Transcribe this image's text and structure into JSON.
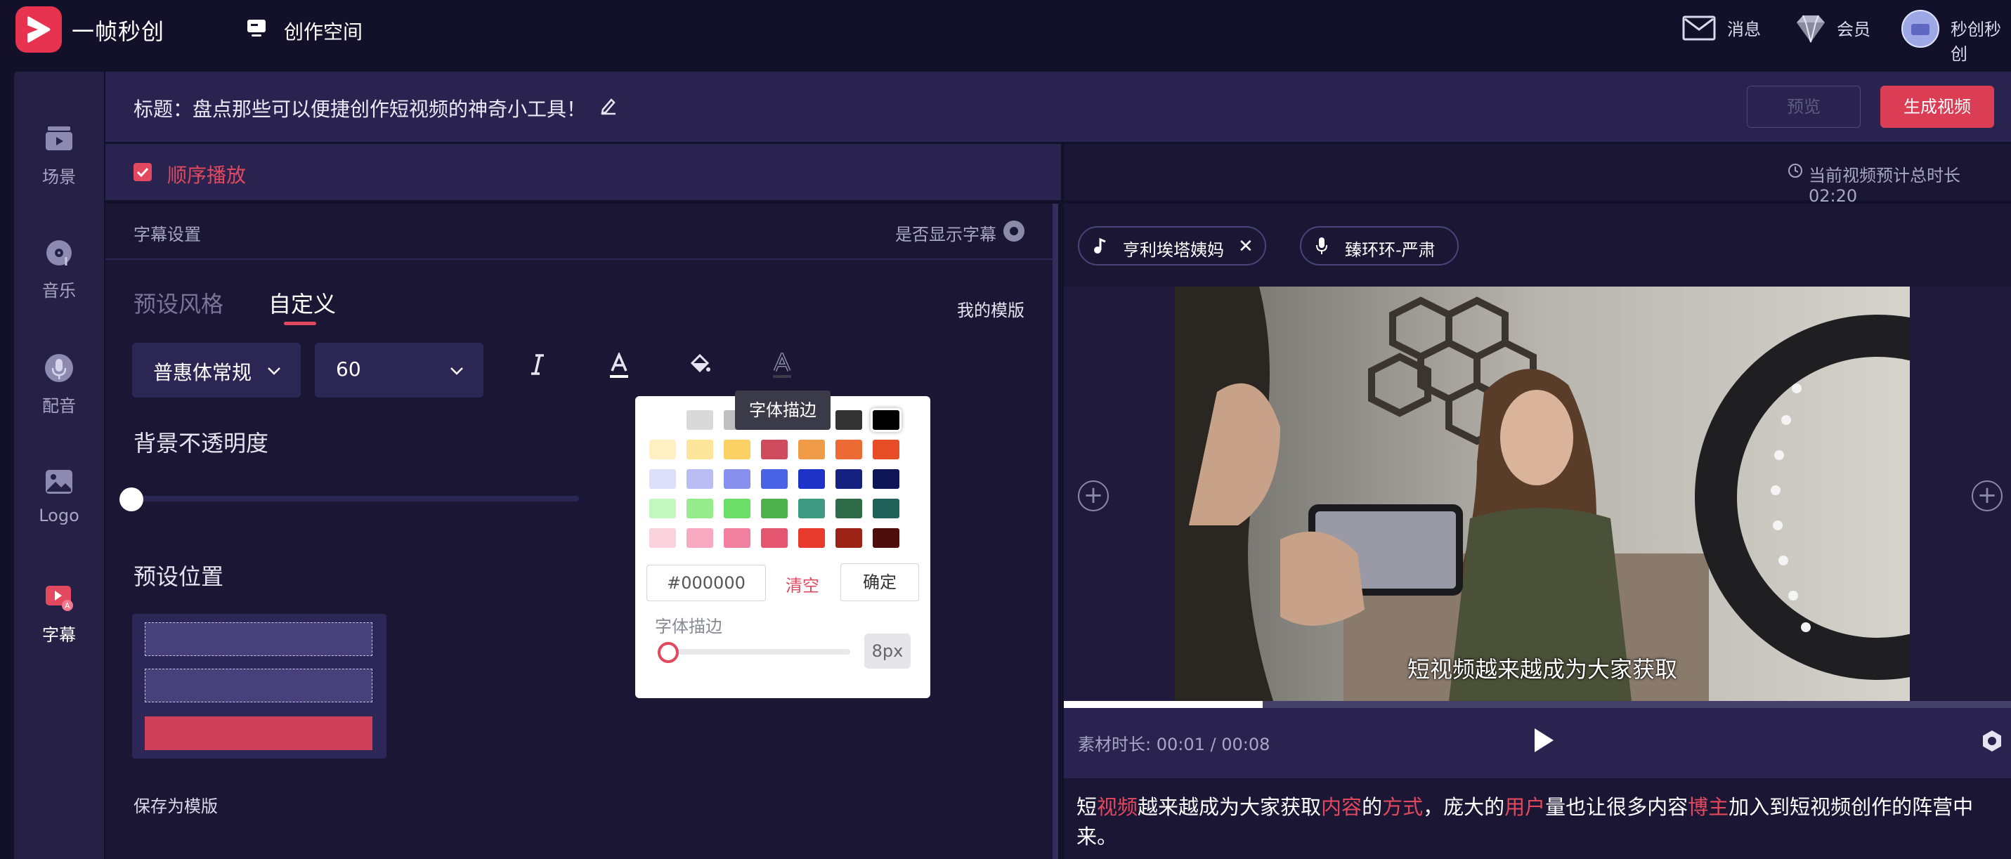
{
  "app": {
    "brand": "一帧秒创",
    "workspace_label": "创作空间",
    "messages_label": "消息",
    "member_label": "会员",
    "username": "秒创秒创"
  },
  "sidebar": {
    "items": [
      {
        "label": "场景",
        "icon": "scene-icon"
      },
      {
        "label": "音乐",
        "icon": "music-icon"
      },
      {
        "label": "配音",
        "icon": "voice-icon"
      },
      {
        "label": "Logo",
        "icon": "logo-image-icon"
      },
      {
        "label": "字幕",
        "icon": "subtitle-icon"
      }
    ],
    "active_index": 4
  },
  "titlebar": {
    "title": "标题：盘点那些可以便捷创作短视频的神奇小工具！",
    "preview_label": "预览",
    "generate_label": "生成视频"
  },
  "sequence": {
    "label": "顺序播放",
    "checked": true
  },
  "subtitle_panel": {
    "section_label": "字幕设置",
    "show_subtitle_label": "是否显示字幕",
    "tabs": [
      "预设风格",
      "自定义"
    ],
    "active_tab": 1,
    "my_template_label": "我的模版",
    "font_family": "普惠体常规",
    "font_size": "60",
    "bg_opacity_label": "背景不透明度",
    "bg_opacity_value": 0,
    "preset_position_label": "预设位置",
    "selected_position": "bottom",
    "save_template_label": "保存为模版"
  },
  "color_picker": {
    "tooltip": "字体描边",
    "swatch_rows": [
      [
        "#ffffff",
        "#d9d9d9",
        "#bfbfbf",
        "#8c8c8c",
        "#595959",
        "#333333",
        "#000000"
      ],
      [
        "#fff1c4",
        "#fde59a",
        "#fbd164",
        "#cf4c5f",
        "#f09b48",
        "#ec6a34",
        "#e84c26"
      ],
      [
        "#dddff8",
        "#b9bdf4",
        "#8790ec",
        "#4a63e6",
        "#1d32c7",
        "#14217f",
        "#0e1657"
      ],
      [
        "#c2f8bd",
        "#95ec8c",
        "#6bde6a",
        "#4db24e",
        "#3f9a82",
        "#2d6c47",
        "#20625a"
      ],
      [
        "#f9d2de",
        "#f6a9c1",
        "#f07fa0",
        "#e4566f",
        "#e93b2d",
        "#9c2417",
        "#4e0f0c"
      ]
    ],
    "hex_value": "#000000",
    "clear_label": "清空",
    "confirm_label": "确定",
    "stroke_label": "字体描边",
    "stroke_value": "8px",
    "accent_color": "#e2495e"
  },
  "preview": {
    "estimated_duration": "当前视频预计总时长 02:20",
    "music_chip": "亨利埃塔姨妈",
    "voice_chip": "臻环环-严肃",
    "caption": "短视频越来越成为大家获取",
    "material_time": "素材时长: 00:01 / 00:08",
    "progress": 0.21,
    "sentence_parts": [
      {
        "text": "短",
        "hl": false
      },
      {
        "text": "视频",
        "hl": true
      },
      {
        "text": "越来越成为大家获取",
        "hl": false
      },
      {
        "text": "内容",
        "hl": true
      },
      {
        "text": "的",
        "hl": false
      },
      {
        "text": "方式",
        "hl": true
      },
      {
        "text": "，庞大的",
        "hl": false
      },
      {
        "text": "用户",
        "hl": true
      },
      {
        "text": "量也让很多内容",
        "hl": false
      },
      {
        "text": "博主",
        "hl": true
      },
      {
        "text": "加入到短视频创作的阵营中来。",
        "hl": false
      }
    ]
  }
}
